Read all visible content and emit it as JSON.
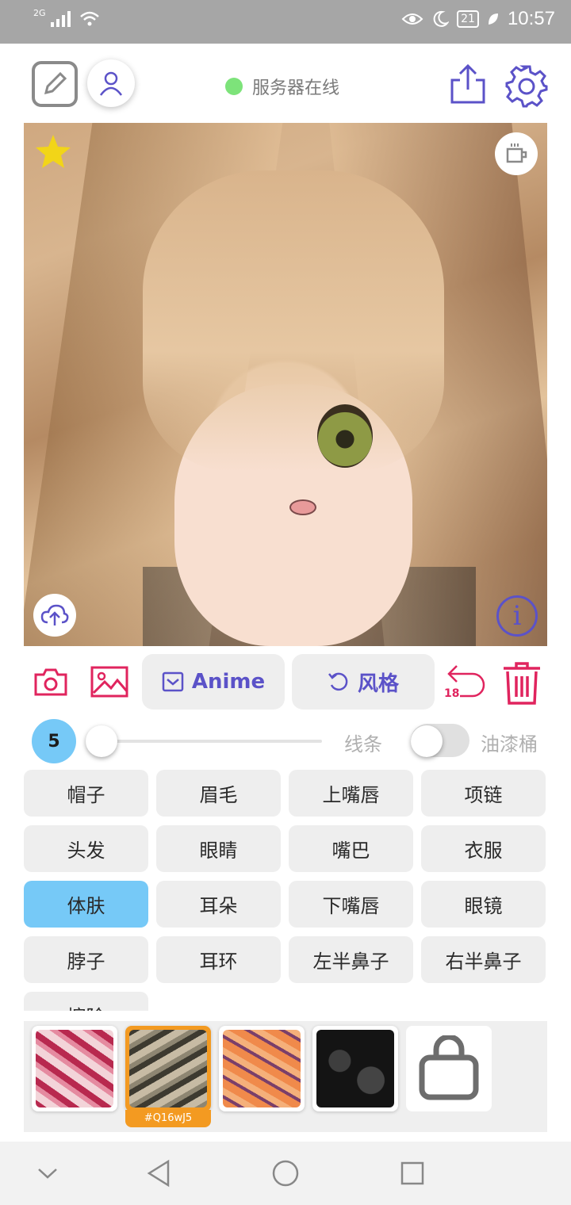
{
  "status_bar": {
    "network": "2G",
    "battery": "21",
    "time": "10:57"
  },
  "header": {
    "server_status": "服务器在线"
  },
  "toolbar": {
    "anime_label": "Anime",
    "style_label": "风格",
    "undo_count": "18"
  },
  "slider_row": {
    "brush_size": "5",
    "lines_label": "线条",
    "bucket_label": "油漆桶"
  },
  "parts": [
    {
      "label": "帽子"
    },
    {
      "label": "眉毛"
    },
    {
      "label": "上嘴唇"
    },
    {
      "label": "项链"
    },
    {
      "label": "头发"
    },
    {
      "label": "眼睛"
    },
    {
      "label": "嘴巴"
    },
    {
      "label": "衣服"
    },
    {
      "label": "体肤"
    },
    {
      "label": "耳朵"
    },
    {
      "label": "下嘴唇"
    },
    {
      "label": "眼镜"
    },
    {
      "label": "脖子"
    },
    {
      "label": "耳环"
    },
    {
      "label": "左半鼻子"
    },
    {
      "label": "右半鼻子"
    },
    {
      "label": "擦除"
    }
  ],
  "active_part": "体肤",
  "textures": {
    "selected_code": "#Q16wJ5"
  },
  "colors": {
    "accent": "#5b52c8",
    "danger": "#e0245e",
    "highlight": "#76c9f7",
    "online": "#7de37a",
    "selected_texture": "#f39a21"
  }
}
